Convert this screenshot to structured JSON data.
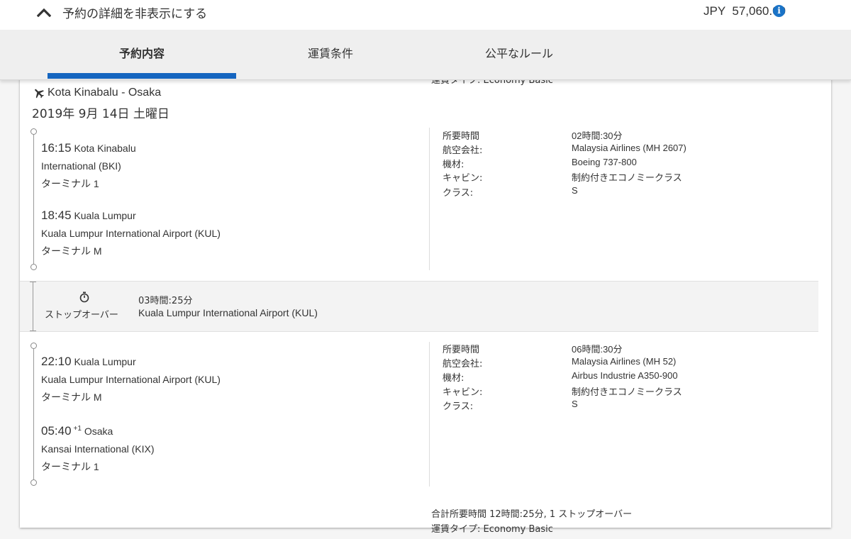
{
  "header": {
    "toggle_label": "予約の詳細を非表示にする",
    "price": "JPY  57,060.00",
    "info_icon": "info-icon"
  },
  "tabs": [
    {
      "label": "予約内容",
      "active": true
    },
    {
      "label": "運賃条件",
      "active": false
    },
    {
      "label": "公平なルール",
      "active": false
    }
  ],
  "colors": {
    "accent": "#1565c0",
    "info": "#1a73c7"
  },
  "route": {
    "title": "Kota Kinabalu - Osaka",
    "date": "2019年 9月 14日 土曜日",
    "icon": "plane-icon"
  },
  "segments": [
    {
      "dep_time": "16:15",
      "dep_city": "Kota Kinabalu",
      "dep_airport": "International (BKI)",
      "dep_terminal": "ターミナル 1",
      "arr_time": "18:45",
      "arr_sup": "",
      "arr_city": "Kuala Lumpur",
      "arr_airport": "Kuala Lumpur International Airport (KUL)",
      "arr_terminal": "ターミナル M",
      "details": [
        {
          "label": "所要時間",
          "value": "02時間:30分"
        },
        {
          "label": "航空会社:",
          "value": "Malaysia Airlines (MH 2607)"
        },
        {
          "label": "機材:",
          "value": "Boeing 737-800"
        },
        {
          "label": "キャビン:",
          "value": "制約付きエコノミークラス"
        },
        {
          "label": "クラス:",
          "value": "S"
        }
      ]
    },
    {
      "dep_time": "22:10",
      "dep_city": "Kuala Lumpur",
      "dep_airport": "Kuala Lumpur International Airport (KUL)",
      "dep_terminal": "ターミナル M",
      "arr_time": "05:40",
      "arr_sup": "+1",
      "arr_city": "Osaka",
      "arr_airport": "Kansai International (KIX)",
      "arr_terminal": "ターミナル 1",
      "details": [
        {
          "label": "所要時間",
          "value": "06時間:30分"
        },
        {
          "label": "航空会社:",
          "value": "Malaysia Airlines (MH 52)"
        },
        {
          "label": "機材:",
          "value": "Airbus Industrie A350-900"
        },
        {
          "label": "キャビン:",
          "value": "制約付きエコノミークラス"
        },
        {
          "label": "クラス:",
          "value": "S"
        }
      ]
    }
  ],
  "stopover": {
    "label": "ストップオーバー",
    "duration": "03時間:25分",
    "airport": "Kuala Lumpur International Airport (KUL)",
    "icon": "stopwatch-icon"
  },
  "summary": {
    "total": "合計所要時間 12時間:25分, 1 ストップオーバー",
    "fare_type": "運賃タイプ: Economy Basic",
    "fare_type_clipped": "運賃タイプ: Economy Basic"
  }
}
